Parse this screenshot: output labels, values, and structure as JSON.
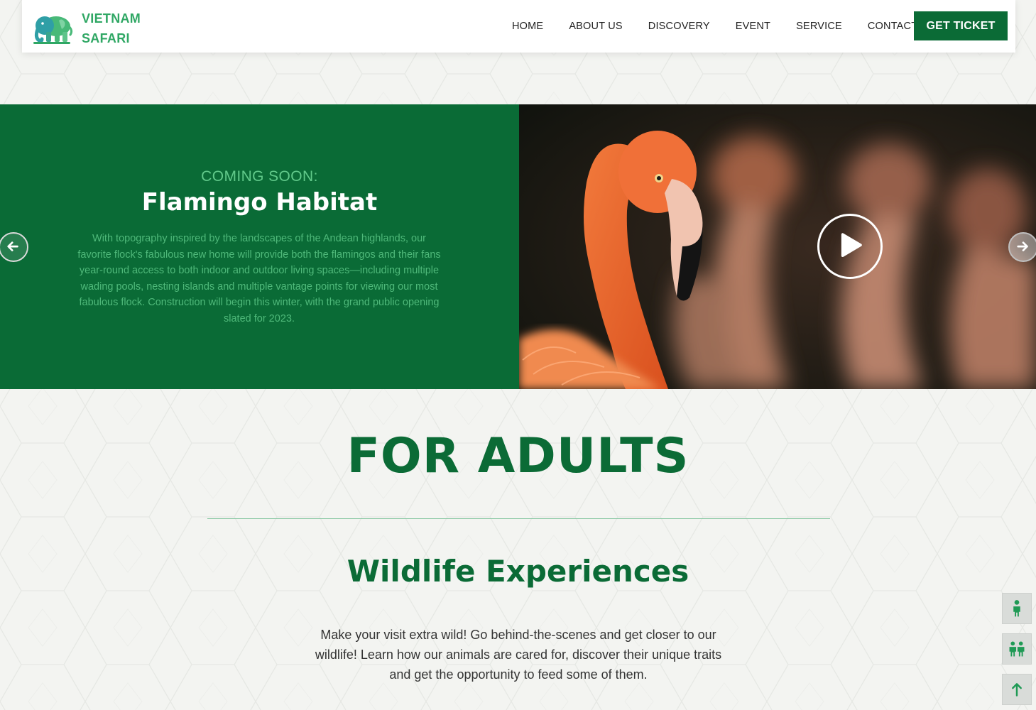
{
  "brand": {
    "line1": "VIETNAM",
    "line2": "SAFARI",
    "logo_icon": "elephant-icon",
    "color": "#2fa764"
  },
  "nav": {
    "items": [
      "HOME",
      "ABOUT US",
      "DISCOVERY",
      "EVENT",
      "SERVICE",
      "CONTACT"
    ],
    "cta": "GET TICKET"
  },
  "hero": {
    "kicker": "COMING SOON:",
    "title": "Flamingo Habitat",
    "description": "With topography inspired by the landscapes of the Andean highlands, our favorite flock's fabulous new home will provide both the flamingos and their fans year-round access to both indoor and outdoor living spaces—including multiple wading pools, nesting islands and multiple vantage points for viewing our most fabulous flock. Construction will begin this winter, with the grand public opening slated for 2023.",
    "play_icon": "play-icon",
    "prev_icon": "arrow-left-icon",
    "next_icon": "arrow-right-icon",
    "panel_color": "#0a6b36"
  },
  "adults": {
    "title": "FOR ADULTS",
    "subtitle": "Wildlife Experiences",
    "description": "Make your visit extra wild! Go behind-the-scenes and get closer to our wildlife! Learn how our animals are cared for, discover their unique traits and get the opportunity to feed some of them."
  },
  "side_buttons": [
    "adult-person-icon",
    "children-icon",
    "arrow-up-icon"
  ],
  "colors": {
    "primary": "#0b6b36",
    "accent": "#2fa764",
    "background": "#f3f4f1"
  }
}
